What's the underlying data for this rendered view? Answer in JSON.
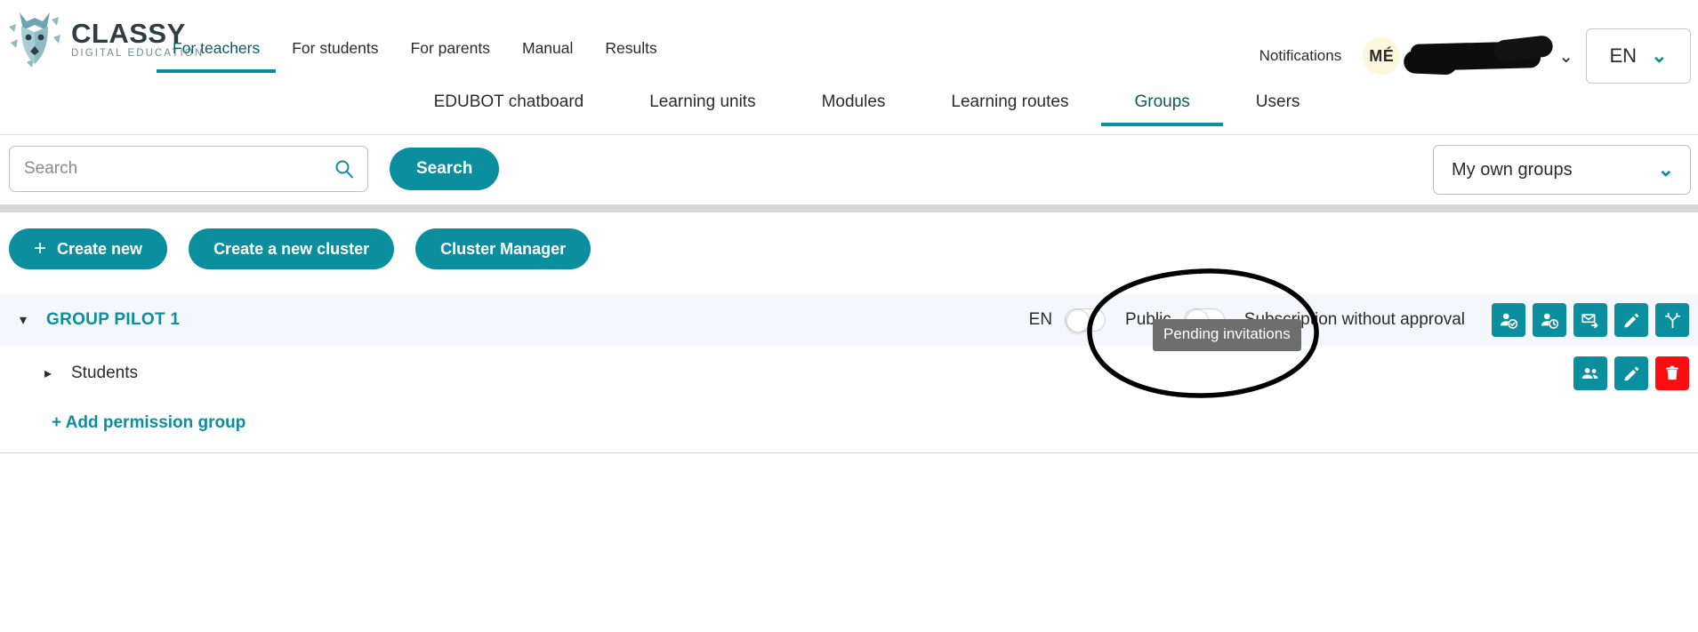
{
  "brand": {
    "name": "CLASSY",
    "tagline": "DIGITAL EDUCATION",
    "logo_icon": "wolf-head-icon",
    "accent_color": "#0b8e9e",
    "dark_color": "#2e3c43"
  },
  "topnav": {
    "items": [
      {
        "label": "For teachers",
        "active": true
      },
      {
        "label": "For students",
        "active": false
      },
      {
        "label": "For parents",
        "active": false
      },
      {
        "label": "Manual",
        "active": false
      },
      {
        "label": "Results",
        "active": false
      }
    ],
    "notifications_label": "Notifications",
    "avatar_initials": "MÉ",
    "username_redacted": "",
    "user_caret_icon": "chevron-down-icon",
    "language": "EN",
    "language_caret_icon": "chevron-down-icon"
  },
  "subnav": {
    "items": [
      {
        "label": "EDUBOT chatboard",
        "active": false
      },
      {
        "label": "Learning units",
        "active": false
      },
      {
        "label": "Modules",
        "active": false
      },
      {
        "label": "Learning routes",
        "active": false
      },
      {
        "label": "Groups",
        "active": true
      },
      {
        "label": "Users",
        "active": false
      }
    ]
  },
  "search": {
    "placeholder": "Search",
    "value": "",
    "icon": "magnifier-icon",
    "button_label": "Search",
    "filter_selected": "My own groups",
    "filter_caret_icon": "chevron-down-icon"
  },
  "actions": {
    "create_new": "Create new",
    "create_new_icon": "plus-icon",
    "create_cluster": "Create a new cluster",
    "cluster_manager": "Cluster Manager"
  },
  "groups": [
    {
      "name": "GROUP PILOT 1",
      "expand_icon": "chevron-down-icon",
      "language": "EN",
      "language_toggle_on": false,
      "public_label": "Public",
      "public_toggle_on": false,
      "subscription_label": "Subscription without approval",
      "actions": [
        {
          "icon": "user-check-icon",
          "name": "approved-members-button",
          "color": "#0b8e9e"
        },
        {
          "icon": "user-clock-icon",
          "name": "pending-members-button",
          "color": "#0b8e9e"
        },
        {
          "icon": "envelope-send-icon",
          "name": "send-invitation-button",
          "color": "#0b8e9e"
        },
        {
          "icon": "pencil-icon",
          "name": "edit-group-button",
          "color": "#0b8e9e"
        },
        {
          "icon": "branch-icon",
          "name": "learning-route-button",
          "color": "#0b8e9e"
        }
      ]
    }
  ],
  "permission_groups": [
    {
      "name": "Students",
      "expand_icon": "chevron-right-icon",
      "actions": [
        {
          "icon": "users-group-icon",
          "name": "manage-members-button",
          "color": "#0b8e9e"
        },
        {
          "icon": "pencil-icon",
          "name": "edit-permission-group-button",
          "color": "#0b8e9e"
        },
        {
          "icon": "trash-icon",
          "name": "delete-permission-group-button",
          "color": "#fb0d10"
        }
      ]
    }
  ],
  "add_permission_group_label": "+ Add permission group",
  "tooltip": {
    "text": "Pending invitations"
  },
  "annotation": {
    "shape": "hand-drawn-ellipse",
    "color": "#000000"
  }
}
